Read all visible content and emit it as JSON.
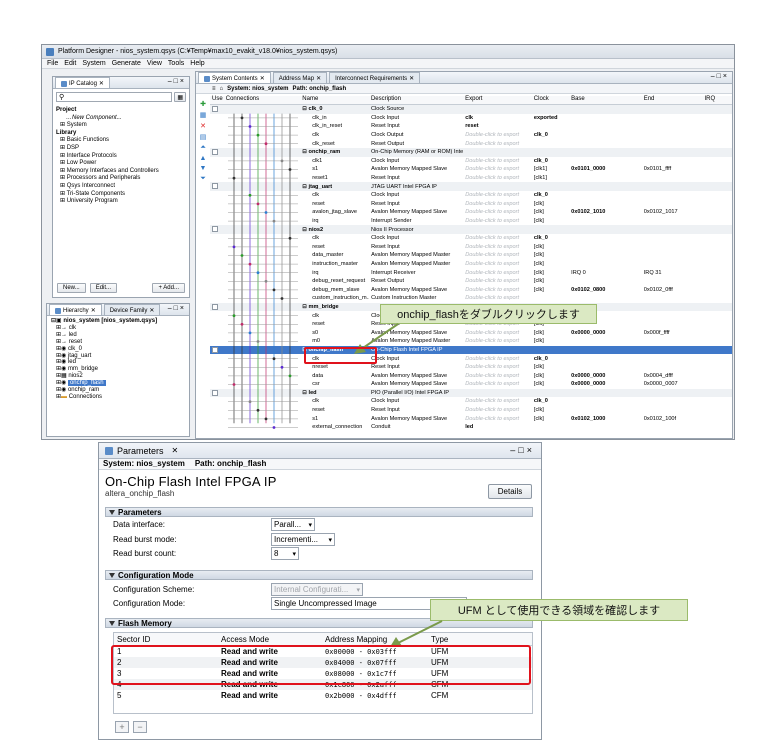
{
  "app": {
    "title": "Platform Designer - nios_system.qsys (C:¥Temp¥max10_evakit_v18.0¥nios_system.qsys)",
    "menu": [
      "File",
      "Edit",
      "System",
      "Generate",
      "View",
      "Tools",
      "Help"
    ]
  },
  "ip_catalog": {
    "tab": "IP Catalog",
    "project_label": "Project",
    "new_component": "New Component...",
    "system": "System",
    "library_label": "Library",
    "library_items": [
      "Basic Functions",
      "DSP",
      "Interface Protocols",
      "Low Power",
      "Memory Interfaces and Controllers",
      "Processors and Peripherals",
      "Qsys Interconnect",
      "Tri-State Components",
      "University Program"
    ],
    "new_btn": "New...",
    "edit_btn": "Edit...",
    "add_btn": "+ Add..."
  },
  "hierarchy": {
    "tabs": [
      "Hierarchy",
      "Device Family"
    ],
    "items": [
      "nios_system [nios_system.qsys]",
      "clk",
      "led",
      "reset",
      "clk_0",
      "jtag_uart",
      "led",
      "mm_bridge",
      "nios2",
      "onchip_flash",
      "onchip_ram",
      "Connections"
    ]
  },
  "system_contents": {
    "tabs": [
      "System Contents",
      "Address Map",
      "Interconnect Requirements"
    ],
    "system_label": "System: nios_system",
    "path_label": "Path: onchip_flash",
    "columns": [
      "Use",
      "Connections",
      "Name",
      "Description",
      "Export",
      "Clock",
      "Base",
      "End",
      "IRQ"
    ],
    "rows": [
      {
        "name": "⊟ clk_0",
        "desc": "Clock Source",
        "exp": "",
        "clk": "",
        "base": "",
        "end": "",
        "grp": true
      },
      {
        "name": "clk_in",
        "desc": "Clock Input",
        "exp": "clk",
        "clk": "exported",
        "base": "",
        "end": ""
      },
      {
        "name": "clk_in_reset",
        "desc": "Reset Input",
        "exp": "reset",
        "clk": "",
        "base": "",
        "end": ""
      },
      {
        "name": "clk",
        "desc": "Clock Output",
        "exp": "Double-click to export",
        "clk": "clk_0",
        "base": "",
        "end": ""
      },
      {
        "name": "clk_reset",
        "desc": "Reset Output",
        "exp": "Double-click to export",
        "clk": "",
        "base": "",
        "end": ""
      },
      {
        "name": "⊟ onchip_ram",
        "desc": "On-Chip Memory (RAM or ROM) Inte...",
        "exp": "",
        "clk": "",
        "base": "",
        "end": "",
        "grp": true
      },
      {
        "name": "clk1",
        "desc": "Clock Input",
        "exp": "Double-click to export",
        "clk": "clk_0",
        "base": "",
        "end": ""
      },
      {
        "name": "s1",
        "desc": "Avalon Memory Mapped Slave",
        "exp": "Double-click to export",
        "clk": "[clk1]",
        "base": "0x0101_0000",
        "end": "0x0101_ffff"
      },
      {
        "name": "reset1",
        "desc": "Reset Input",
        "exp": "Double-click to export",
        "clk": "[clk1]",
        "base": "",
        "end": ""
      },
      {
        "name": "⊟ jtag_uart",
        "desc": "JTAG UART Intel FPGA IP",
        "exp": "",
        "clk": "",
        "base": "",
        "end": "",
        "grp": true
      },
      {
        "name": "clk",
        "desc": "Clock Input",
        "exp": "Double-click to export",
        "clk": "clk_0",
        "base": "",
        "end": ""
      },
      {
        "name": "reset",
        "desc": "Reset Input",
        "exp": "Double-click to export",
        "clk": "[clk]",
        "base": "",
        "end": ""
      },
      {
        "name": "avalon_jtag_slave",
        "desc": "Avalon Memory Mapped Slave",
        "exp": "Double-click to export",
        "clk": "[clk]",
        "base": "0x0102_1010",
        "end": "0x0102_1017"
      },
      {
        "name": "irq",
        "desc": "Interrupt Sender",
        "exp": "Double-click to export",
        "clk": "[clk]",
        "base": "",
        "end": ""
      },
      {
        "name": "⊟ nios2",
        "desc": "Nios II Processor",
        "exp": "",
        "clk": "",
        "base": "",
        "end": "",
        "grp": true
      },
      {
        "name": "clk",
        "desc": "Clock Input",
        "exp": "Double-click to export",
        "clk": "clk_0",
        "base": "",
        "end": ""
      },
      {
        "name": "reset",
        "desc": "Reset Input",
        "exp": "Double-click to export",
        "clk": "[clk]",
        "base": "",
        "end": ""
      },
      {
        "name": "data_master",
        "desc": "Avalon Memory Mapped Master",
        "exp": "Double-click to export",
        "clk": "[clk]",
        "base": "",
        "end": ""
      },
      {
        "name": "instruction_master",
        "desc": "Avalon Memory Mapped Master",
        "exp": "Double-click to export",
        "clk": "[clk]",
        "base": "",
        "end": ""
      },
      {
        "name": "irq",
        "desc": "Interrupt Receiver",
        "exp": "Double-click to export",
        "clk": "[clk]",
        "base": "IRQ 0",
        "end": "IRQ 31"
      },
      {
        "name": "debug_reset_request",
        "desc": "Reset Output",
        "exp": "Double-click to export",
        "clk": "[clk]",
        "base": "",
        "end": ""
      },
      {
        "name": "debug_mem_slave",
        "desc": "Avalon Memory Mapped Slave",
        "exp": "Double-click to export",
        "clk": "[clk]",
        "base": "0x0102_0800",
        "end": "0x0102_0fff"
      },
      {
        "name": "custom_instruction_m...",
        "desc": "Custom Instruction Master",
        "exp": "Double-click to export",
        "clk": "",
        "base": "",
        "end": ""
      },
      {
        "name": "⊟ mm_bridge",
        "desc": "",
        "exp": "",
        "clk": "",
        "base": "",
        "end": "",
        "grp": true
      },
      {
        "name": "clk",
        "desc": "Clock Input",
        "exp": "",
        "clk": "clk_0",
        "base": "",
        "end": ""
      },
      {
        "name": "reset",
        "desc": "Reset Input",
        "exp": "Double-click to export",
        "clk": "[clk]",
        "base": "",
        "end": ""
      },
      {
        "name": "s0",
        "desc": "Avalon Memory Mapped Slave",
        "exp": "Double-click to export",
        "clk": "[clk]",
        "base": "0x0000_0000",
        "end": "0x000f_ffff"
      },
      {
        "name": "m0",
        "desc": "Avalon Memory Mapped Master",
        "exp": "Double-click to export",
        "clk": "[clk]",
        "base": "",
        "end": ""
      },
      {
        "name": "⊟ onchip_flash",
        "desc": "On-Chip Flash Intel FPGA IP",
        "exp": "",
        "clk": "",
        "base": "",
        "end": "",
        "sel": true
      },
      {
        "name": "clk",
        "desc": "Clock Input",
        "exp": "Double-click to export",
        "clk": "clk_0",
        "base": "",
        "end": ""
      },
      {
        "name": "nreset",
        "desc": "Reset Input",
        "exp": "Double-click to export",
        "clk": "[clk]",
        "base": "",
        "end": ""
      },
      {
        "name": "data",
        "desc": "Avalon Memory Mapped Slave",
        "exp": "Double-click to export",
        "clk": "[clk]",
        "base": "0x0000_0000",
        "end": "0x0004_dfff"
      },
      {
        "name": "csr",
        "desc": "Avalon Memory Mapped Slave",
        "exp": "Double-click to export",
        "clk": "[clk]",
        "base": "0x0000_0000",
        "end": "0x0000_0007"
      },
      {
        "name": "⊟ led",
        "desc": "PIO (Parallel I/O) Intel FPGA IP",
        "exp": "",
        "clk": "",
        "base": "",
        "end": "",
        "grp": true
      },
      {
        "name": "clk",
        "desc": "Clock Input",
        "exp": "Double-click to export",
        "clk": "clk_0",
        "base": "",
        "end": ""
      },
      {
        "name": "reset",
        "desc": "Reset Input",
        "exp": "Double-click to export",
        "clk": "[clk]",
        "base": "",
        "end": ""
      },
      {
        "name": "s1",
        "desc": "Avalon Memory Mapped Slave",
        "exp": "Double-click to export",
        "clk": "[clk]",
        "base": "0x0102_1000",
        "end": "0x0102_100f"
      },
      {
        "name": "external_connection",
        "desc": "Conduit",
        "exp": "led",
        "clk": "",
        "base": "",
        "end": ""
      }
    ]
  },
  "callouts": {
    "top": "onchip_flashをダブルクリックします",
    "bottom": "UFM として使用できる領域を確認します"
  },
  "parameters": {
    "tab": "Parameters",
    "system_label": "System: nios_system",
    "path_label": "Path: onchip_flash",
    "component_title": "On-Chip Flash Intel FPGA IP",
    "component_sub": "altera_onchip_flash",
    "details_btn": "Details",
    "section_params": "Parameters",
    "data_interface_label": "Data interface:",
    "data_interface_value": "Parall...",
    "read_burst_mode_label": "Read burst mode:",
    "read_burst_mode_value": "Incrementi...",
    "read_burst_count_label": "Read burst count:",
    "read_burst_count_value": "8",
    "section_config": "Configuration Mode",
    "config_scheme_label": "Configuration Scheme:",
    "config_scheme_value": "Internal Configurati...",
    "config_mode_label": "Configuration Mode:",
    "config_mode_value": "Single Uncompressed Image",
    "section_flash": "Flash Memory",
    "flash_columns": [
      "Sector ID",
      "Access Mode",
      "Address Mapping",
      "Type"
    ],
    "flash_rows": [
      {
        "id": "1",
        "mode": "Read and write",
        "map": "0x00000 - 0x03fff",
        "type": "UFM"
      },
      {
        "id": "2",
        "mode": "Read and write",
        "map": "0x04000 - 0x07fff",
        "type": "UFM"
      },
      {
        "id": "3",
        "mode": "Read and write",
        "map": "0x08000 - 0x1c7ff",
        "type": "UFM"
      },
      {
        "id": "4",
        "mode": "Read and write",
        "map": "0x1c800 - 0x2afff",
        "type": "CFM"
      },
      {
        "id": "5",
        "mode": "Read and write",
        "map": "0x2b000 - 0x4dfff",
        "type": "CFM"
      }
    ]
  },
  "colors": {
    "highlight_red": "#e0121c",
    "callout_green": "#dbe9c3",
    "selection_blue": "#3f78c9"
  }
}
